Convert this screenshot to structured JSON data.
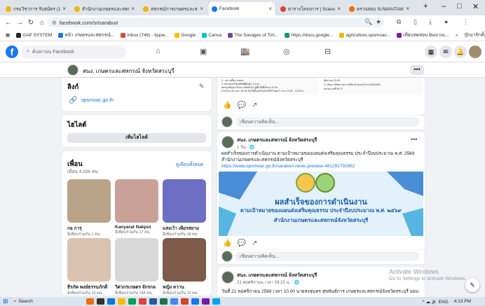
{
  "browser": {
    "tabs": [
      {
        "label": "กรมวิชาการ รับสมัคร (1)",
        "color": "#f4b400",
        "active": false
      },
      {
        "label": "สำนักงานเกษตรและสหกรณ์",
        "color": "#f4b400",
        "active": false
      },
      {
        "label": "สหกรณ์การเกษตรและสหกรณ์",
        "color": "#f4b400",
        "active": false
      },
      {
        "label": "Facebook",
        "color": "#1877f2",
        "active": true
      },
      {
        "label": "ตารางโครงการ | SciencePR",
        "color": "#db4437",
        "active": false
      },
      {
        "label": "ตรวจสอบ SUWANTAWNS",
        "color": "#e8710a",
        "active": false
      }
    ],
    "new_tab": "+",
    "window_controls": [
      "–",
      "□",
      "✕"
    ],
    "url": "facebook.com/srisaraburi",
    "bookmarks": [
      {
        "label": "GAP SYSTEM",
        "color": "#222222"
      },
      {
        "label": "หน้า เกษตรและสหกรณ์...",
        "color": "#1877f2"
      },
      {
        "label": "Inbox (746) - tippw...",
        "color": "#db4437"
      },
      {
        "label": "Google",
        "color": "#fbbc05"
      },
      {
        "label": "Canva",
        "color": "#00c4cc"
      },
      {
        "label": "The Savages of Tim...",
        "color": "#6a4c93"
      },
      {
        "label": "https://docs.google...",
        "color": "#0f9d58"
      },
      {
        "label": "agriculture.opsmoac...",
        "color": "#f4b400"
      },
      {
        "label": "เทียบทดสอบ Best Inc...",
        "color": "#7b1fa2"
      },
      {
        "label": "»",
        "color": "transparent"
      },
      {
        "label": "บุ๊กมาร์กทั้งหมด",
        "color": "transparent"
      }
    ]
  },
  "fb": {
    "search_placeholder": "ค้นหาบน Facebook",
    "page_name": "สนง. เกษตรและสหกรณ์ จังหวัดสระบุรี",
    "more": "•••"
  },
  "left": {
    "links_title": "ลิงก์",
    "link_url": "opsmoac.go.th",
    "highlights_title": "ไฮไลต์",
    "add_highlight": "เพิ่มไฮไลต์",
    "friends_title": "เพื่อน",
    "friends_count": "เพื่อน 4,026 คน",
    "see_all": "ดูเพื่อนทั้งหมด",
    "friends": [
      {
        "name": "กอ การุ",
        "sub": "มีเพื่อนร่วมกัน 1 คน",
        "color": "#b9a48a"
      },
      {
        "name": "Kanyarat Nakpul",
        "sub": "มีเพื่อนร่วมกัน 17 คน",
        "color": "#c9a199"
      },
      {
        "name": "แสงเว้า เพียรสยาม",
        "sub": "มีเพื่อนร่วมกัน 18 คน",
        "color": "#6c6fc4"
      },
      {
        "name": "ธีรภัค พงษ์ธรรมภักดี",
        "sub": "มีเพื่อนร่วมกัน 10 คน",
        "color": "#d9c3b0"
      },
      {
        "name": "วิศวกรเกษตร จักรกล",
        "sub": "มีเพื่อนร่วมกัน 148 คน",
        "color": "#d8d8d8"
      },
      {
        "name": "หญิง หวาน",
        "sub": "มีเพื่อนร่วมกัน 19 คน",
        "color": "#7d5a49"
      }
    ]
  },
  "feed": {
    "prev_post_lines": [
      "1 - สถานที่ตรวจสอบ",
      "2. หมายเลขโทรศัพท์ผู้ติดต่อ 1 ท่าน",
      "ผลของปัญหาเรื่องการตัดสินใจ ผู้ซื้อใช้ชีวิตประจำวัน",
      "ภายในระยะเวลา 15 วัน นับได้ตั้งแต่วันจันทร์ถึงวันศุกร์ เวลา 12:00 - 13:00 น."
    ],
    "prev_post_right": [
      "อัตราผล 15.49",
      "2. เน้นการติดตามความคืบหน้าทุกคนในระดับจังหวัด",
      "หน่วยงานที่ 46.77"
    ],
    "comment_placeholder": "เขียนความคิดเห็น...",
    "post2": {
      "author": "สนง. เกษตรและสหกรณ์ จังหวัดสระบุรี",
      "time": "1 วัน · 🌐",
      "body": "ผลสำเร็จของการดำเนินงาน ตามเป้าหมายของแผนส่งเสริมคุณธรรม ประจำปีงบประมาณ พ.ศ. 2569 สำนักงานเกษตรและสหกรณ์จังหวัดสระบุรี",
      "link": "https://www.opsmoac.go.th/saraburi-news-preview-481291792852",
      "banner_line1": "ผลสำเร็จของการดำเนินงาน",
      "banner_line2": "ตามเป้าหมายของแผนส่งเสริมคุณธรรม ประจำปีงบประมาณ พ.ศ. ๒๕๖๙",
      "banner_line3": "สำนักงานเกษตรและสหกรณ์จังหวัดสระบุรี"
    },
    "post3": {
      "author": "สนง. เกษตรและสหกรณ์ จังหวัดสระบุรี",
      "time": "21 พฤศจิกายน เวลา 19:15 น. · 🌐",
      "body": "วันที่ 21 พฤศจิกายน 2569 เวลา 10.00 นายสงสุนทร สุขพันธ์การ เกษตรและสหกรณ์จังหวัดสระบุรี มอบ"
    }
  },
  "os": {
    "activate_title": "Activate Windows",
    "activate_sub": "Go to Settings to activate Windows.",
    "search": "Search",
    "clock": "4:13 PM",
    "tray": "^ ☁ 🔊 ENG"
  },
  "colors": {
    "fb_blue": "#1877f2",
    "banner_bg": "#2f7bd0",
    "banner_light": "#e3f1fb"
  }
}
